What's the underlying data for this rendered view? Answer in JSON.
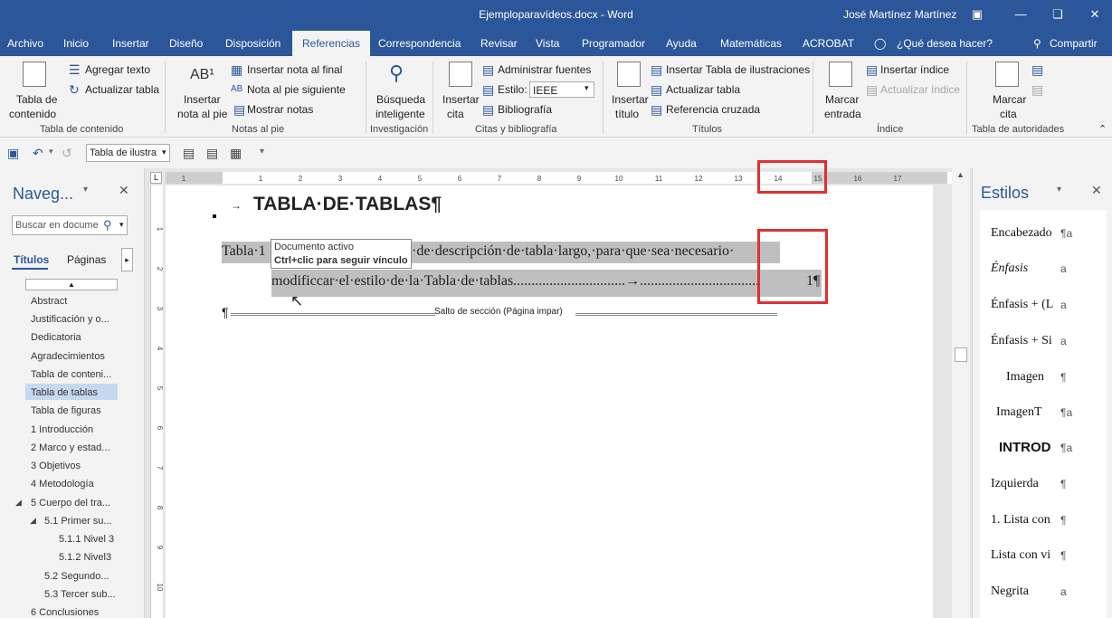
{
  "titlebar": {
    "doc_title": "Ejemploparavídeos.docx - Word",
    "user": "José Martínez Martínez",
    "ribbon_display_icon": "ribbon-display-icon",
    "minimize_icon": "minimize-icon",
    "restore_icon": "restore-icon",
    "close_icon": "close-icon"
  },
  "tabs": {
    "archivo": "Archivo",
    "inicio": "Inicio",
    "insertar": "Insertar",
    "diseno": "Diseño",
    "disposicion": "Disposición",
    "referencias": "Referencias",
    "correspondencia": "Correspondencia",
    "revisar": "Revisar",
    "vista": "Vista",
    "programador": "Programador",
    "ayuda": "Ayuda",
    "matematicas": "Matemáticas",
    "acrobat": "ACROBAT",
    "tell_me": "¿Qué desea hacer?",
    "compartir": "Compartir"
  },
  "ribbon": {
    "toc_line1": "Tabla de",
    "toc_line2": "contenido",
    "agregar_texto": "Agregar texto",
    "actualizar_tabla": "Actualizar tabla",
    "grp_toc": "Tabla de contenido",
    "insertar_nota_line1": "Insertar",
    "insertar_nota_line2": "nota al pie",
    "insertar_nota_final": "Insertar nota al final",
    "nota_siguiente": "Nota al pie siguiente",
    "mostrar_notas": "Mostrar notas",
    "grp_notas": "Notas al pie",
    "busqueda_line1": "Búsqueda",
    "busqueda_line2": "inteligente",
    "grp_investigacion": "Investigación",
    "insertar_cita_line1": "Insertar",
    "insertar_cita_line2": "cita",
    "administrar_fuentes": "Administrar fuentes",
    "estilo_label": "Estilo:",
    "estilo_value": "IEEE",
    "bibliografia": "Bibliografía",
    "grp_citas": "Citas y bibliografía",
    "insertar_titulo_line1": "Insertar",
    "insertar_titulo_line2": "título",
    "insertar_tabla_ilustraciones": "Insertar Tabla de ilustraciones",
    "actualizar_tabla2": "Actualizar tabla",
    "referencia_cruzada": "Referencia cruzada",
    "grp_titulos": "Títulos",
    "marcar_entrada_line1": "Marcar",
    "marcar_entrada_line2": "entrada",
    "insertar_indice": "Insertar índice",
    "actualizar_indice": "Actualizar índice",
    "grp_indice": "Índice",
    "marcar_cita_line1": "Marcar",
    "marcar_cita_line2": "cita",
    "grp_autoridades": "Tabla de autoridades"
  },
  "qat": {
    "style_box": "Tabla de ilustra"
  },
  "nav": {
    "title": "Naveg...",
    "search_placeholder": "Buscar en docume",
    "tab_titulos": "Títulos",
    "tab_paginas": "Páginas",
    "items": [
      "Abstract",
      "Justificación y o...",
      "Dedicatoria",
      "Agradecimientos",
      "Tabla de conteni...",
      "Tabla de tablas",
      "Tabla de figuras",
      "1 Introducción",
      "2 Marco y estad...",
      "3 Objetivos",
      "4 Metodología",
      "5 Cuerpo del tra...",
      "5.1 Primer su...",
      "5.1.1 Nivel 3",
      "5.1.2 Nivel3",
      "5.2 Segundo...",
      "5.3 Tercer sub...",
      "6 Conclusiones"
    ]
  },
  "ruler": {
    "ticks": [
      "1",
      "1",
      "2",
      "3",
      "4",
      "5",
      "6",
      "7",
      "8",
      "9",
      "10",
      "11",
      "12",
      "13",
      "14",
      "15",
      "16",
      "17"
    ],
    "vticks": [
      "1",
      "2",
      "3",
      "4",
      "5",
      "6",
      "7",
      "8",
      "9",
      "10"
    ]
  },
  "document": {
    "heading": "TABLA·DE·TABLAS¶",
    "toc_line1_a": "Tabla·1",
    "toc_line1_b": "·de·descripción·de·tabla·largo,·para·que·sea·necesario·",
    "toc_line2": "modificcar·el·estilo·de·la·Tabla·de·tablas...............................→.................................",
    "toc_page": "1¶",
    "tooltip_title": "Documento activo",
    "tooltip_hint": "Ctrl+clic para seguir vínculo",
    "section_break": "Salto de sección (Página impar)",
    "pilcrow": "¶"
  },
  "styles_pane": {
    "title": "Estilos",
    "items": [
      {
        "name": "Encabezado",
        "mark": "¶a"
      },
      {
        "name": "Énfasis",
        "mark": "a"
      },
      {
        "name": "Énfasis + (L",
        "mark": "a"
      },
      {
        "name": "Énfasis + Si",
        "mark": "a"
      },
      {
        "name": "Imagen",
        "mark": "¶"
      },
      {
        "name": "ImagenT",
        "mark": "¶a"
      },
      {
        "name": "INTROD",
        "mark": "¶a"
      },
      {
        "name": "Izquierda",
        "mark": "¶"
      },
      {
        "name": "1.  Lista con",
        "mark": "¶"
      },
      {
        "name": "Lista con vi",
        "mark": "¶"
      },
      {
        "name": "Negrita",
        "mark": "a"
      }
    ]
  },
  "colors": {
    "word_blue": "#2b579a",
    "highlight": "#bfbfbf",
    "annotation_red": "#e03030"
  }
}
